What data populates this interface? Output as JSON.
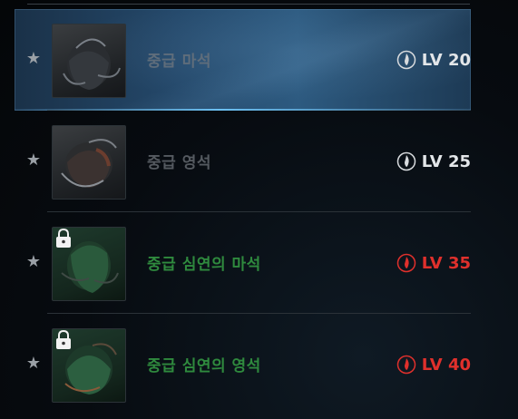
{
  "colors": {
    "accent_selected": "#2d5a80",
    "level_normal": "#e3e6e9",
    "level_locked": "#e0302c",
    "name_normal": "#555a60",
    "name_special": "#2f8a3e"
  },
  "items": [
    {
      "name": "중급 마석",
      "level": "LV 20",
      "icon": "stone-pouch-icon",
      "locked": false,
      "selected": true,
      "level_icon": "white-flame-icon"
    },
    {
      "name": "중급 영석",
      "level": "LV 25",
      "icon": "stone-pouch-icon",
      "locked": false,
      "selected": false,
      "level_icon": "white-flame-icon"
    },
    {
      "name": "중급 심연의 마석",
      "level": "LV 35",
      "icon": "green-stone-pouch-icon",
      "locked": true,
      "selected": false,
      "level_icon": "red-flame-icon"
    },
    {
      "name": "중급 심연의 영석",
      "level": "LV 40",
      "icon": "green-stone-pouch-icon",
      "locked": true,
      "selected": false,
      "level_icon": "red-flame-icon"
    }
  ]
}
